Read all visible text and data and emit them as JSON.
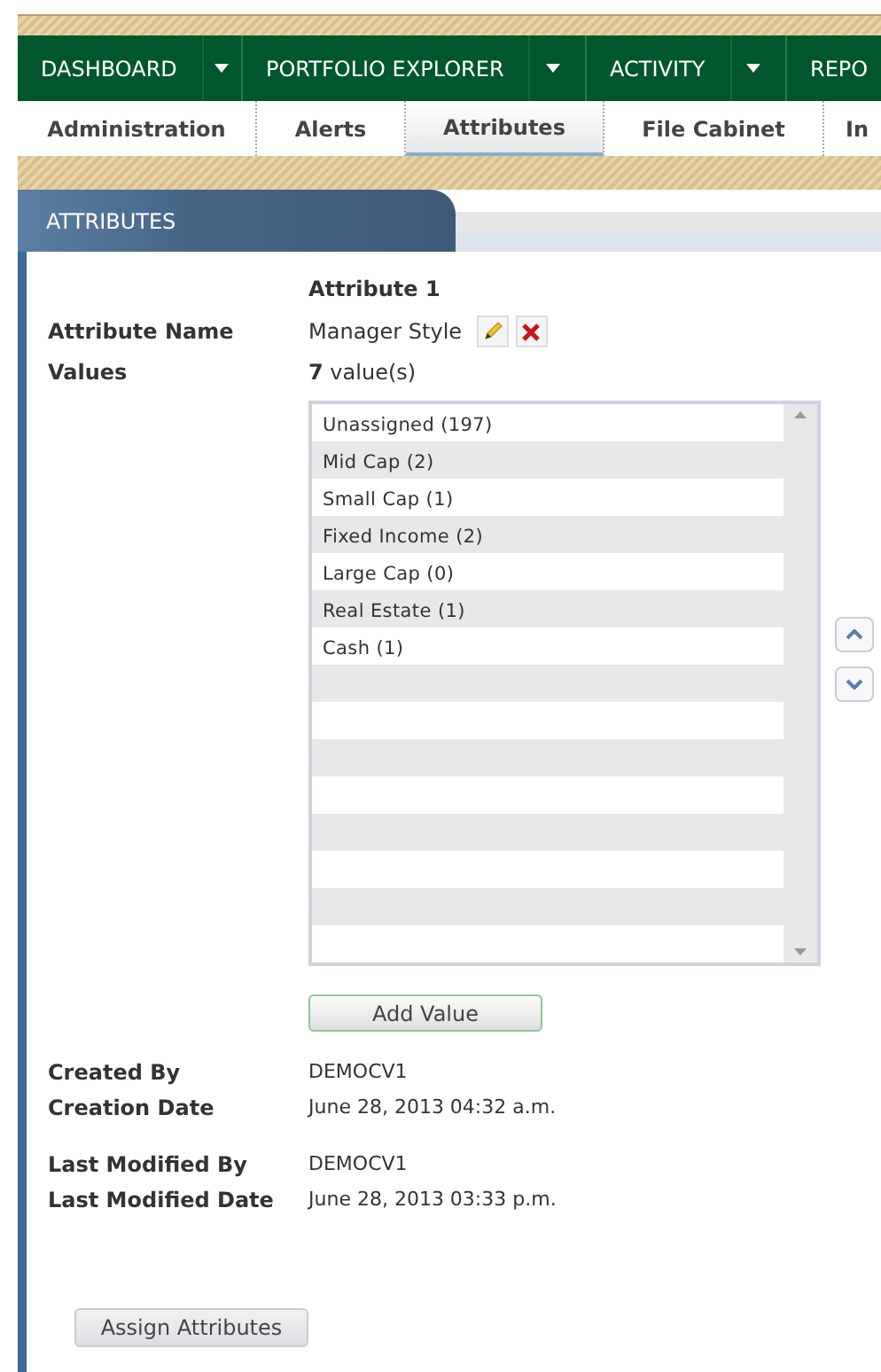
{
  "main_nav": [
    {
      "label": "DASHBOARD",
      "has_menu": true
    },
    {
      "label": "PORTFOLIO EXPLORER",
      "has_menu": true
    },
    {
      "label": "ACTIVITY",
      "has_menu": true
    },
    {
      "label": "REPO",
      "has_menu": false
    }
  ],
  "sub_tabs": [
    {
      "label": "Administration",
      "selected": false
    },
    {
      "label": "Alerts",
      "selected": false
    },
    {
      "label": "Attributes",
      "selected": true
    },
    {
      "label": "File Cabinet",
      "selected": false
    },
    {
      "label": "In",
      "selected": false
    }
  ],
  "panel": {
    "title": "ATTRIBUTES",
    "heading": "Attribute 1",
    "name_label": "Attribute Name",
    "name_value": "Manager Style",
    "values_label": "Values",
    "values_count": "7",
    "values_suffix": "value(s)",
    "values": [
      "Unassigned (197)",
      "Mid Cap (2)",
      "Small Cap (1)",
      "Fixed Income (2)",
      "Large Cap (0)",
      "Real Estate (1)",
      "Cash (1)"
    ],
    "add_button": "Add Value",
    "meta": [
      {
        "label": "Created By",
        "value": "DEMOCV1"
      },
      {
        "label": "Creation Date",
        "value": "June 28, 2013 04:32 a.m."
      },
      {
        "label": "Last Modified By",
        "value": "DEMOCV1"
      },
      {
        "label": "Last Modified Date",
        "value": "June 28, 2013 03:33 p.m."
      }
    ],
    "assign_button": "Assign Attributes"
  }
}
